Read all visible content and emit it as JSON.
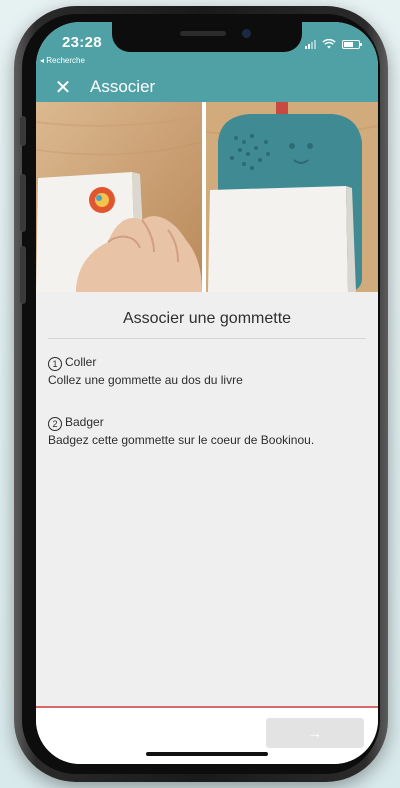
{
  "status_bar": {
    "time": "23:28",
    "back_app": "◂ Recherche"
  },
  "nav": {
    "close_glyph": "✕",
    "title": "Associer"
  },
  "content": {
    "section_title": "Associer une gommette",
    "steps": [
      {
        "number": "1",
        "title": "Coller",
        "description": "Collez une gommette au dos du livre"
      },
      {
        "number": "2",
        "title": "Badger",
        "description": "Badgez cette gommette sur le coeur de Bookinou."
      }
    ]
  },
  "footer": {
    "next_glyph": "→"
  },
  "colors": {
    "header": "#4fa1a6",
    "accent_line": "#d66a6a",
    "disabled_button": "#e3e3e3",
    "device_teal": "#3f8a93"
  },
  "icons": {
    "close": "close-icon",
    "next": "arrow-right-icon",
    "signal": "signal-icon",
    "wifi": "wifi-icon",
    "battery": "battery-icon"
  }
}
